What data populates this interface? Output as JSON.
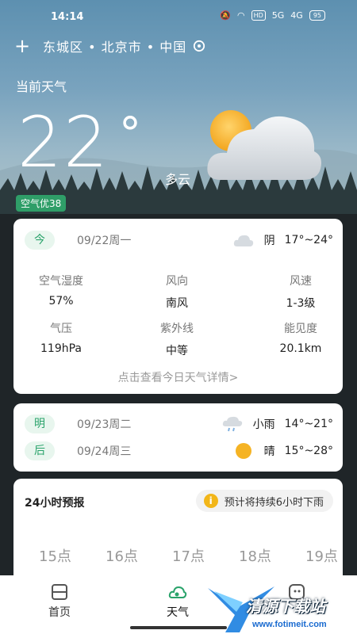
{
  "status_bar": {
    "time": "14:14",
    "net_badge": "HD",
    "signal1": "5G",
    "signal2": "4G",
    "battery": "95"
  },
  "location": {
    "add_icon": "plus-icon",
    "text": "东城区 • 北京市 • 中国",
    "pin_icon": "location-pin-icon"
  },
  "current": {
    "label": "当前天气",
    "temperature": "22",
    "unit": "°",
    "condition": "多云",
    "aqi": "空气优38",
    "icon": "partly-cloudy-icon"
  },
  "today": {
    "pill": "今",
    "date": "09/22周一",
    "weather": "阴",
    "range": "17°~24°",
    "icon": "cloud-icon",
    "details": [
      {
        "label": "空气湿度",
        "value": "57%"
      },
      {
        "label": "风向",
        "value": "南风"
      },
      {
        "label": "风速",
        "value": "1-3级"
      },
      {
        "label": "气压",
        "value": "119hPa"
      },
      {
        "label": "紫外线",
        "value": "中等"
      },
      {
        "label": "能见度",
        "value": "20.1km"
      }
    ],
    "detail_link": "点击查看今日天气详情>"
  },
  "forecast": [
    {
      "pill": "明",
      "date": "09/23周二",
      "weather": "小雨",
      "range": "14°~21°",
      "icon": "light-rain-icon"
    },
    {
      "pill": "后",
      "date": "09/24周三",
      "weather": "晴",
      "range": "15°~28°",
      "icon": "sun-icon"
    }
  ],
  "hourly": {
    "title": "24小时预报",
    "tip_icon": "info-icon",
    "tip_glyph": "i",
    "tip": "预计将持续6小时下雨",
    "hours": [
      "15点",
      "16点",
      "17点",
      "18点",
      "19点"
    ]
  },
  "nav": [
    {
      "label": "首页",
      "icon": "home-icon"
    },
    {
      "label": "天气",
      "icon": "weather-icon"
    },
    {
      "label": "",
      "icon": "profile-icon"
    }
  ],
  "watermark": {
    "text": "清源下载站",
    "url": "www.fotimeit.com"
  },
  "colors": {
    "accent": "#2aa36b",
    "aqi": "#2f9e68",
    "tip": "#f2b619"
  }
}
